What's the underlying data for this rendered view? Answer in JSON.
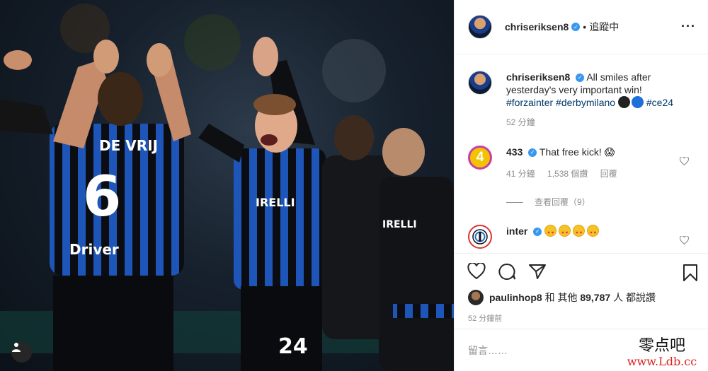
{
  "post": {
    "author": "chriseriksen8",
    "follow_status": "追蹤中",
    "caption_text": "All smiles after yesterday's very important win!",
    "caption_tags": "#forzainter #derbymilano",
    "caption_tag_end": "#ce24",
    "caption_time": "52 分鐘"
  },
  "comments": [
    {
      "user": "433",
      "text": "That free kick! 😱",
      "time": "41 分鐘",
      "likes": "1,538 個讚",
      "reply": "回覆",
      "view_replies": "查看回覆（9）",
      "avatar_text": "4"
    },
    {
      "user": "inter",
      "text": ""
    }
  ],
  "likes": {
    "user": "paulinhop8",
    "conj": "和 其他",
    "count": "89,787",
    "suffix": "人 都說讚"
  },
  "time_ago": "52 分鐘前",
  "comment_placeholder": "留言……",
  "photo": {
    "jersey_left_name": "DE VRIJ",
    "jersey_left_number": "6",
    "sponsor": "Driver",
    "sponsor_center": "IRELLI",
    "jersey_center_number": "24",
    "sponsor_right": "IRELLI"
  },
  "watermark": {
    "cn": "零点吧",
    "url": "www.Ldb.cc"
  },
  "colors": {
    "verified": "#3897f0",
    "link": "#00376b",
    "muted": "#8e8e8e"
  }
}
